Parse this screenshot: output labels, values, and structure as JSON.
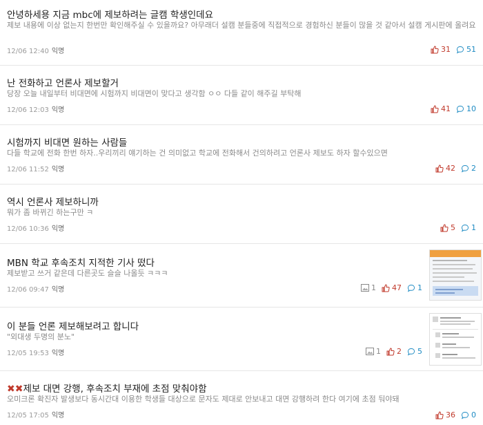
{
  "posts": [
    {
      "title": "안녕하세용 지금 mbc에 제보하려는 글캠 학생인데요",
      "excerpt": "제보 내용에 이상 없는지 한번만 확인해주실 수 있을까요? 아무래더 설캠 분들중에 직접적으로 경험하신 분들이 많을 것 같아서 설캠 게시판에 올려요",
      "time": "12/06 12:40",
      "author": "익명",
      "likes": "31",
      "comments": "51"
    },
    {
      "title": "난 전화하고 언론사 제보할거",
      "excerpt": "당장 오늘 내일부터 비대면에 시험까지 비대면이 맞다고 생각함 ㅇㅇ 다들 같이 해주길 부탁해",
      "time": "12/06 12:03",
      "author": "익명",
      "likes": "41",
      "comments": "10"
    },
    {
      "title": "시험까지 비대면 원하는 사람들",
      "excerpt": "다들 학교에 전화 한번 하자..우리끼리 얘기하는 건 의미없고 학교에 전화해서 건의하려고 언론사 제보도 하자 할수있으면",
      "time": "12/06 11:52",
      "author": "익명",
      "likes": "42",
      "comments": "2"
    },
    {
      "title": "역시 언론사 제보하니까",
      "excerpt": "뭐가 좀 바뀌긴 하는구만 ㅋ",
      "time": "12/06 10:36",
      "author": "익명",
      "likes": "5",
      "comments": "1"
    },
    {
      "title": "MBN 학교 후속조치 지적한 기사 떴다",
      "excerpt": "제보받고 쓰거 같은데 다른곳도 슬슬 나올듯 ㅋㅋㅋ",
      "time": "12/06 09:47",
      "author": "익명",
      "images": "1",
      "likes": "47",
      "comments": "1"
    },
    {
      "title": "이 분들 언론 제보해보려고 합니다",
      "excerpt": "\"외대생 두명의 분노\"",
      "time": "12/05 19:53",
      "author": "익명",
      "images": "1",
      "likes": "2",
      "comments": "5"
    },
    {
      "title_prefix": "✖✖",
      "title": "제보 대면 강행, 후속조치 부재에 초점 맞춰야함",
      "excerpt": "오미크론 확진자 발생보다 동시간대 이용한 학생들 대상으로 문자도 제대로 안보내고 대면 강행하려 한다 여기에 초점 둬야돼",
      "time": "12/05 17:05",
      "author": "익명",
      "likes": "36",
      "comments": "0"
    }
  ]
}
